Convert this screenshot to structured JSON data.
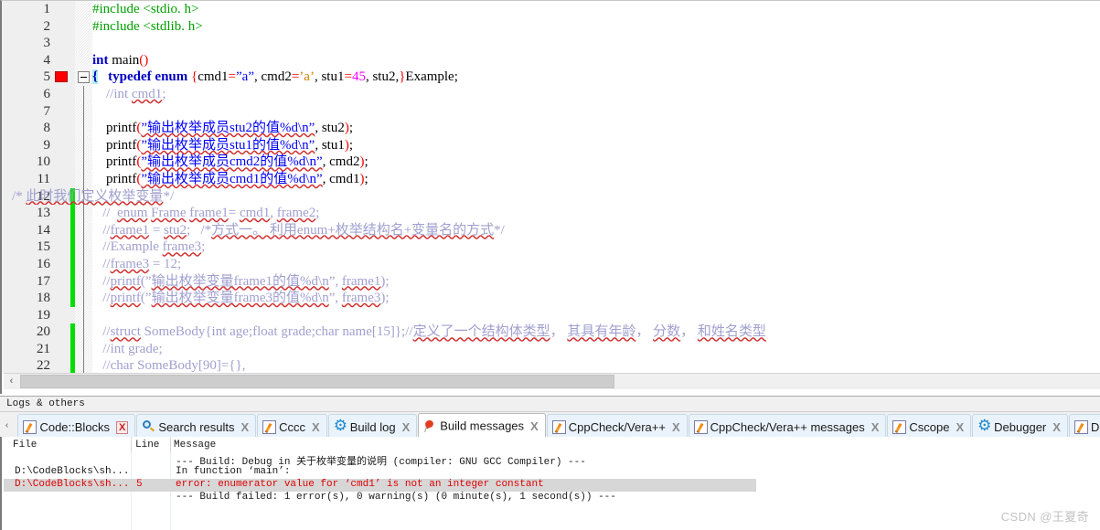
{
  "editor": {
    "gutter_fold_line": 5,
    "error_marker_line": 5,
    "lines": [
      {
        "n": "1",
        "changed": false,
        "html": "<span class=\"pp\">#include &lt;stdio. h&gt;</span>"
      },
      {
        "n": "2",
        "changed": false,
        "html": "<span class=\"pp\">#include &lt;stdlib. h&gt;</span>"
      },
      {
        "n": "3",
        "changed": false,
        "html": ""
      },
      {
        "n": "4",
        "changed": false,
        "html": "<span class=\"k\">int</span> <span class=\"id\">main</span><span class=\"op\">()</span>"
      },
      {
        "n": "5",
        "changed": false,
        "html": "<span class=\"sel-brace\">{</span>   <span class=\"k\">typedef</span> <span class=\"k\">enum</span> <span class=\"op\">{</span><span class=\"id\">cmd1</span><span class=\"op\">=</span><span class=\"st\">”a”</span><span class=\"id\">, cmd2</span><span class=\"op\">=</span><span class=\"chr\">’a’</span><span class=\"id\">, stu1</span><span class=\"op\">=</span><span class=\"num\">45</span><span class=\"id\">, stu2,</span><span class=\"op\">}</span><span class=\"id\">Example;</span>"
      },
      {
        "n": "6",
        "changed": false,
        "html": "    <span class=\"cm\">//int <span class=\"sq\">cmd1</span>;</span>"
      },
      {
        "n": "7",
        "changed": false,
        "html": ""
      },
      {
        "n": "8",
        "changed": false,
        "html": "    <span class=\"id\">printf</span><span class=\"op\">(</span><span class=\"st sq\">”输出枚举成员stu2的值%d\\n”</span><span class=\"id\">, stu2</span><span class=\"op\">)</span><span class=\"id\">;</span>"
      },
      {
        "n": "9",
        "changed": false,
        "html": "    <span class=\"id\">printf</span><span class=\"op\">(</span><span class=\"st sq\">”输出枚举成员stu1的值%d\\n”</span><span class=\"id\">, stu1</span><span class=\"op\">)</span><span class=\"id\">;</span>"
      },
      {
        "n": "10",
        "changed": false,
        "html": "    <span class=\"id\">printf</span><span class=\"op\">(</span><span class=\"st sq\">”输出枚举成员cmd2的值%d\\n”</span><span class=\"id\">, cmd2</span><span class=\"op\">)</span><span class=\"id\">;</span>"
      },
      {
        "n": "11",
        "changed": false,
        "html": "    <span class=\"id\">printf</span><span class=\"op\">(</span><span class=\"st sq\">”输出枚举成员cmd1的值%d\\n”</span><span class=\"id\">, cmd1</span><span class=\"op\">)</span><span class=\"id\">;</span>"
      },
      {
        "n": "12",
        "changed": true,
        "html": "<span class=\"cm\" style=\"margin-left:-88px\">/* <span class=\"sq\">此时我们定义枚举变量</span>*/</span>"
      },
      {
        "n": "13",
        "changed": true,
        "html": "   <span class=\"cm\">//  <span class=\"sq\">enum</span> <span class=\"sq\">Frame</span> <span class=\"sq\">frame1</span>= <span class=\"sq\">cmd1</span>, <span class=\"sq\">frame2</span>;</span>"
      },
      {
        "n": "14",
        "changed": true,
        "html": "   <span class=\"cm\">//<span class=\"sq\">frame1</span> = <span class=\"sq\">stu2</span>;   /*<span class=\"sq\">方式一。 利用enum+枚举结构名+变量名的方式</span>*/</span>"
      },
      {
        "n": "15",
        "changed": true,
        "html": "   <span class=\"cm\">//Example <span class=\"sq\">frame3</span>;</span>"
      },
      {
        "n": "16",
        "changed": true,
        "html": "   <span class=\"cm\">//<span class=\"sq\">frame3</span> = 12;</span>"
      },
      {
        "n": "17",
        "changed": true,
        "html": "   <span class=\"cm\">//<span class=\"sq\">printf</span>(”<span class=\"sq\">输出枚举变量frame1的值%d\\n</span>”, <span class=\"sq\">frame1</span>);</span>"
      },
      {
        "n": "18",
        "changed": true,
        "html": "   <span class=\"cm\">//<span class=\"sq\">printf</span>(”<span class=\"sq\">输出枚举变量frame3的值%d\\n</span>”, <span class=\"sq\">frame3</span>);</span>"
      },
      {
        "n": "19",
        "changed": false,
        "html": ""
      },
      {
        "n": "20",
        "changed": true,
        "html": "   <span class=\"cm\">//<span class=\"sq\">struct</span> SomeBody{int age;float grade;char name[15]};//<span class=\"sq\">定义了一个结构体类型</span>， <span class=\"sq\">其具有年龄</span>， <span class=\"sq\">分数</span>， <span class=\"sq\">和姓名类型</span></span>"
      },
      {
        "n": "21",
        "changed": true,
        "html": "   <span class=\"cm\">//int grade;</span>"
      },
      {
        "n": "22",
        "changed": true,
        "html": "   <span class=\"cm\">//char SomeBody[90]={},</span>"
      }
    ],
    "hscroll": {
      "left_arrow": "‹"
    }
  },
  "logs": {
    "caption": "Logs & others",
    "scroll_left_arrow": "‹",
    "tabs": [
      {
        "label": "Code::Blocks",
        "icon": "pencil-icon",
        "active": false,
        "close": "X",
        "close_red": true
      },
      {
        "label": "Search results",
        "icon": "magnifier-icon",
        "active": false,
        "close": "X",
        "close_red": false
      },
      {
        "label": "Cccc",
        "icon": "pencil-icon",
        "active": false,
        "close": "X",
        "close_red": false
      },
      {
        "label": "Build log",
        "icon": "gear-icon",
        "active": false,
        "close": "X",
        "close_red": false
      },
      {
        "label": "Build messages",
        "icon": "pin-icon",
        "active": true,
        "close": "X",
        "close_red": false
      },
      {
        "label": "CppCheck/Vera++",
        "icon": "pencil-icon",
        "active": false,
        "close": "X",
        "close_red": false
      },
      {
        "label": "CppCheck/Vera++ messages",
        "icon": "pencil-icon",
        "active": false,
        "close": "X",
        "close_red": false
      },
      {
        "label": "Cscope",
        "icon": "pencil-icon",
        "active": false,
        "close": "X",
        "close_red": false
      },
      {
        "label": "Debugger",
        "icon": "gear-icon",
        "active": false,
        "close": "X",
        "close_red": false
      },
      {
        "label": "Dox",
        "icon": "pencil-icon",
        "active": false,
        "close": "",
        "close_red": false
      }
    ]
  },
  "messages": {
    "columns": [
      "File",
      "Line",
      "Message"
    ],
    "rows": [
      {
        "file": "",
        "line": "",
        "message": "--- Build: Debug in 关于枚举变量的说明 (compiler: GNU GCC Compiler) ---",
        "error": false,
        "selected": false
      },
      {
        "file": "D:\\CodeBlocks\\sh...",
        "line": "",
        "message": "In function ‘main’:",
        "error": false,
        "selected": false
      },
      {
        "file": "D:\\CodeBlocks\\sh...",
        "line": "5",
        "message": "error: enumerator value for ‘cmd1’ is not an integer constant",
        "error": true,
        "selected": true
      },
      {
        "file": "",
        "line": "",
        "message": "--- Build failed: 1 error(s), 0 warning(s) (0 minute(s), 1 second(s)) ---",
        "error": false,
        "selected": false
      }
    ]
  },
  "watermark": {
    "text": "CSDN @王夏奇"
  },
  "colors": {
    "error_red": "#e00000",
    "comment_lavender": "#a0a0d0",
    "string_blue": "#0000ff",
    "keyword_blue": "#0000c0",
    "preproc_green": "#00a000",
    "number_magenta": "#ff00ff",
    "changebar_green": "#00e000",
    "selection_grey": "#d7d7d7"
  }
}
